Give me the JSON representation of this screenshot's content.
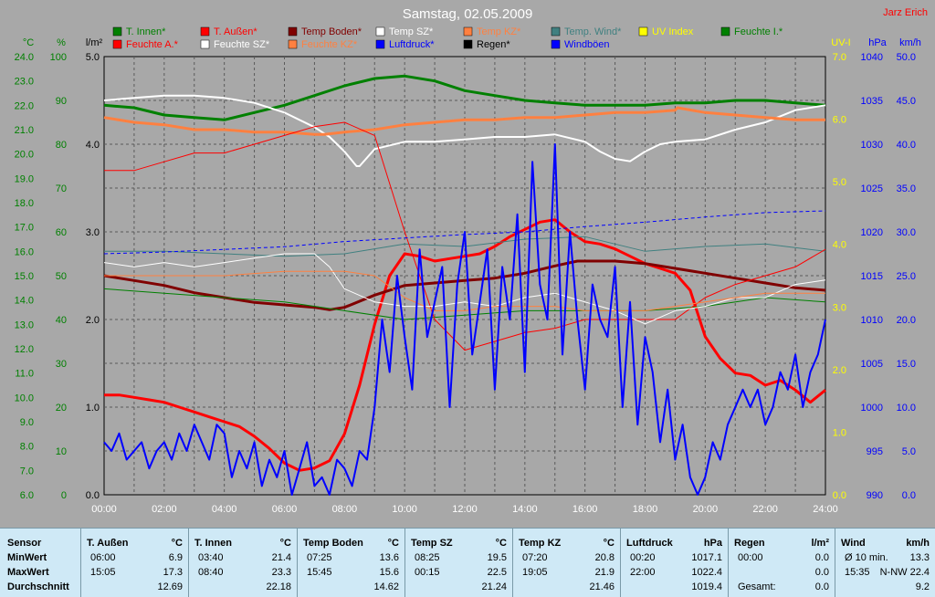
{
  "title": "Samstag, 02.05.2009",
  "author": "Jarz Erich",
  "legend": [
    {
      "label": "T. Innen*",
      "color": "#008000"
    },
    {
      "label": "T. Außen*",
      "color": "#ff0000"
    },
    {
      "label": "Temp Boden*",
      "color": "#800000"
    },
    {
      "label": "Temp SZ*",
      "color": "#ffffff"
    },
    {
      "label": "Temp KZ*",
      "color": "#ff8040"
    },
    {
      "label": "Temp. Wind*",
      "color": "#408080"
    },
    {
      "label": "UV Index",
      "color": "#ffff00"
    },
    {
      "label": "Feuchte I.*",
      "color": "#008000"
    },
    {
      "label": "Feuchte A.*",
      "color": "#ff0000"
    },
    {
      "label": "Feuchte SZ*",
      "color": "#ffffff"
    },
    {
      "label": "Feuchte KZ*",
      "color": "#ff8040"
    },
    {
      "label": "Luftdruck*",
      "color": "#0000ff"
    },
    {
      "label": "Regen*",
      "color": "#000000"
    },
    {
      "label": "Windböen",
      "color": "#0000ff"
    }
  ],
  "axis_units": {
    "temp": "°C",
    "hum": "%",
    "rain": "l/m²",
    "uv": "UV-I",
    "press": "hPa",
    "wind": "km/h"
  },
  "chart_data": {
    "type": "line",
    "x_ticks": [
      "00:00",
      "02:00",
      "04:00",
      "06:00",
      "08:00",
      "10:00",
      "12:00",
      "14:00",
      "16:00",
      "18:00",
      "20:00",
      "22:00",
      "24:00"
    ],
    "axes": {
      "temp": {
        "range": [
          6.0,
          24.0
        ],
        "ticks": [
          "24.0",
          "23.0",
          "22.0",
          "21.0",
          "20.0",
          "19.0",
          "18.0",
          "17.0",
          "16.0",
          "15.0",
          "14.0",
          "13.0",
          "12.0",
          "11.0",
          "10.0",
          "9.0",
          "8.0",
          "7.0",
          "6.0"
        ]
      },
      "hum": {
        "range": [
          0,
          100
        ],
        "ticks": [
          "100",
          "90",
          "80",
          "70",
          "60",
          "50",
          "40",
          "30",
          "20",
          "10",
          "0"
        ]
      },
      "rain": {
        "range": [
          0.0,
          5.0
        ],
        "ticks": [
          "5.0",
          "4.0",
          "3.0",
          "2.0",
          "1.0",
          "0.0"
        ]
      },
      "uv": {
        "range": [
          0.0,
          7.0
        ],
        "ticks": [
          "7.0",
          "6.0",
          "5.0",
          "4.0",
          "3.0",
          "2.0",
          "1.0",
          "0.0"
        ]
      },
      "press": {
        "range": [
          990,
          1040
        ],
        "ticks": [
          "1040",
          "1035",
          "1030",
          "1025",
          "1020",
          "1015",
          "1010",
          "1005",
          "1000",
          "995",
          "990"
        ]
      },
      "wind": {
        "range": [
          0.0,
          50.0
        ],
        "ticks": [
          "50.0",
          "45.0",
          "40.0",
          "35.0",
          "30.0",
          "25.0",
          "20.0",
          "15.0",
          "10.0",
          "5.0",
          "0.0"
        ]
      }
    },
    "series": [
      {
        "name": "T. Innen*",
        "axis": "temp",
        "color": "#008000",
        "width": 3,
        "x": [
          0,
          1,
          2,
          3,
          4,
          5,
          6,
          7,
          8,
          9,
          10,
          11,
          12,
          13,
          14,
          15,
          16,
          17,
          18,
          19,
          20,
          21,
          22,
          23,
          24
        ],
        "y": [
          22.0,
          21.9,
          21.6,
          21.5,
          21.4,
          21.7,
          22.0,
          22.4,
          22.8,
          23.1,
          23.2,
          23.0,
          22.6,
          22.4,
          22.2,
          22.1,
          22.0,
          22.0,
          22.0,
          22.1,
          22.1,
          22.2,
          22.2,
          22.1,
          22.0
        ]
      },
      {
        "name": "T. Außen*",
        "axis": "temp",
        "color": "#ff0000",
        "width": 3,
        "x": [
          0,
          0.5,
          1,
          1.5,
          2,
          2.5,
          3,
          3.5,
          4,
          4.5,
          5,
          5.5,
          6,
          6.5,
          7,
          7.5,
          8,
          8.5,
          9,
          9.5,
          10,
          10.5,
          11,
          11.5,
          12,
          12.5,
          13,
          13.5,
          14,
          14.5,
          15,
          15.5,
          16,
          16.5,
          17,
          17.5,
          18,
          18.5,
          19,
          19.5,
          20,
          20.5,
          21,
          21.5,
          22,
          22.5,
          23,
          23.5,
          24
        ],
        "y": [
          10.1,
          10.1,
          10.0,
          9.9,
          9.8,
          9.6,
          9.4,
          9.2,
          9.0,
          8.8,
          8.4,
          7.9,
          7.3,
          7.0,
          7.1,
          7.4,
          8.5,
          10.5,
          13.0,
          15.0,
          15.9,
          15.8,
          15.6,
          15.7,
          15.8,
          15.9,
          16.2,
          16.6,
          16.9,
          17.2,
          17.3,
          16.8,
          16.4,
          16.3,
          16.1,
          15.8,
          15.5,
          15.3,
          15.1,
          14.4,
          12.5,
          11.6,
          11.0,
          10.9,
          10.5,
          10.7,
          10.3,
          9.8,
          10.3
        ]
      },
      {
        "name": "Temp Boden*",
        "axis": "temp",
        "color": "#800000",
        "width": 3,
        "x": [
          0,
          1,
          2,
          3,
          4,
          5,
          6,
          7,
          7.5,
          8,
          9,
          10,
          11,
          12,
          13,
          14,
          15,
          15.75,
          16,
          17,
          18,
          19,
          20,
          21,
          22,
          23,
          24
        ],
        "y": [
          15.0,
          14.8,
          14.6,
          14.3,
          14.1,
          13.9,
          13.8,
          13.7,
          13.6,
          13.7,
          14.2,
          14.6,
          14.7,
          14.8,
          14.9,
          15.1,
          15.4,
          15.6,
          15.6,
          15.6,
          15.5,
          15.3,
          15.1,
          14.9,
          14.7,
          14.5,
          14.4
        ]
      },
      {
        "name": "Temp SZ*",
        "axis": "temp",
        "color": "#ffffff",
        "width": 2,
        "x": [
          0,
          1,
          2,
          3,
          4,
          5,
          6,
          7,
          7.5,
          8,
          8.4,
          8.5,
          9,
          10,
          11,
          12,
          13,
          14,
          15,
          16,
          16.5,
          17,
          17.5,
          18,
          18.5,
          19,
          20,
          21,
          22,
          23,
          24
        ],
        "y": [
          22.2,
          22.3,
          22.4,
          22.4,
          22.3,
          22.1,
          21.7,
          21.1,
          20.7,
          20.1,
          19.5,
          19.5,
          20.2,
          20.5,
          20.5,
          20.6,
          20.7,
          20.7,
          20.8,
          20.5,
          20.1,
          19.8,
          19.7,
          20.1,
          20.4,
          20.5,
          20.6,
          21.0,
          21.3,
          21.8,
          22.0
        ]
      },
      {
        "name": "Temp KZ*",
        "axis": "temp",
        "color": "#ff8040",
        "width": 3,
        "x": [
          0,
          1,
          2,
          3,
          4,
          5,
          6,
          7,
          7.33,
          8,
          9,
          10,
          11,
          12,
          13,
          14,
          15,
          16,
          17,
          18,
          19,
          19.08,
          20,
          21,
          22,
          23,
          24
        ],
        "y": [
          21.5,
          21.3,
          21.2,
          21.0,
          21.0,
          20.9,
          20.9,
          20.8,
          20.8,
          20.9,
          21.0,
          21.2,
          21.3,
          21.4,
          21.4,
          21.5,
          21.5,
          21.6,
          21.7,
          21.7,
          21.8,
          21.9,
          21.7,
          21.6,
          21.5,
          21.4,
          21.4
        ]
      },
      {
        "name": "Temp. Wind*",
        "axis": "temp",
        "color": "#408080",
        "width": 1,
        "x": [
          0,
          2,
          4,
          6,
          8,
          10,
          12,
          14,
          16,
          18,
          20,
          22,
          24
        ],
        "y": [
          16.0,
          16.0,
          15.9,
          15.8,
          15.9,
          16.3,
          16.2,
          16.5,
          16.6,
          16.0,
          16.2,
          16.3,
          16.0
        ]
      },
      {
        "name": "Feuchte I.*",
        "axis": "hum",
        "color": "#008000",
        "width": 1,
        "x": [
          0,
          2,
          4,
          6,
          8,
          10,
          12,
          14,
          16,
          18,
          20,
          22,
          24
        ],
        "y": [
          47,
          46,
          45,
          44,
          42,
          40,
          41,
          42,
          42,
          42,
          43,
          45,
          44
        ]
      },
      {
        "name": "Feuchte A.*",
        "axis": "hum",
        "color": "#ff0000",
        "width": 1,
        "x": [
          0,
          1,
          2,
          3,
          4,
          5,
          6,
          7,
          8,
          9,
          10,
          11,
          12,
          13,
          14,
          15,
          16,
          17,
          18,
          19,
          20,
          21,
          22,
          23,
          24
        ],
        "y": [
          74,
          74,
          76,
          78,
          78,
          80,
          82,
          84,
          85,
          82,
          60,
          40,
          33,
          35,
          37,
          38,
          40,
          40,
          40,
          40,
          45,
          48,
          50,
          52,
          56
        ]
      },
      {
        "name": "Feuchte SZ*",
        "axis": "hum",
        "color": "#ffffff",
        "width": 1,
        "x": [
          0,
          1,
          2,
          3,
          4,
          5,
          6,
          7,
          7.5,
          8,
          9,
          10,
          11,
          12,
          13,
          14,
          15,
          16,
          17,
          18,
          19,
          20,
          21,
          22,
          23,
          24
        ],
        "y": [
          53,
          52,
          53,
          52,
          53,
          54,
          55,
          55,
          52,
          47,
          44,
          43,
          43,
          44,
          43,
          45,
          46,
          44,
          42,
          39,
          42,
          43,
          45,
          45,
          48,
          49
        ]
      },
      {
        "name": "Feuchte KZ*",
        "axis": "hum",
        "color": "#ff8040",
        "width": 1,
        "x": [
          0,
          2,
          4,
          6,
          8,
          9,
          10,
          11,
          12,
          13,
          14,
          15,
          16,
          17,
          18,
          19,
          20,
          21,
          22,
          23,
          24
        ],
        "y": [
          50,
          50,
          50,
          51,
          51,
          50,
          45,
          42,
          42,
          43,
          43,
          43,
          42,
          42,
          42,
          43,
          44,
          45,
          46,
          46,
          46
        ]
      },
      {
        "name": "Luftdruck*",
        "axis": "press",
        "color": "#0000ff",
        "width": 1,
        "dashed": true,
        "x": [
          0,
          2,
          4,
          6,
          8,
          10,
          12,
          14,
          16,
          18,
          20,
          22,
          24
        ],
        "y": [
          1017.5,
          1017.7,
          1018.0,
          1018.3,
          1018.9,
          1019.3,
          1019.7,
          1020.0,
          1020.6,
          1021.1,
          1021.7,
          1022.2,
          1022.4
        ]
      },
      {
        "name": "Windböen",
        "axis": "wind",
        "color": "#0000ff",
        "width": 2,
        "x": [
          0,
          0.25,
          0.5,
          0.75,
          1,
          1.25,
          1.5,
          1.75,
          2,
          2.25,
          2.5,
          2.75,
          3,
          3.25,
          3.5,
          3.75,
          4,
          4.25,
          4.5,
          4.75,
          5,
          5.25,
          5.5,
          5.75,
          6,
          6.25,
          6.5,
          6.75,
          7,
          7.25,
          7.5,
          7.75,
          8,
          8.25,
          8.5,
          8.75,
          9,
          9.25,
          9.5,
          9.75,
          10,
          10.25,
          10.5,
          10.75,
          11,
          11.25,
          11.5,
          11.75,
          12,
          12.25,
          12.5,
          12.75,
          13,
          13.25,
          13.5,
          13.75,
          14,
          14.25,
          14.5,
          14.75,
          15,
          15.25,
          15.5,
          15.75,
          16,
          16.25,
          16.5,
          16.75,
          17,
          17.25,
          17.5,
          17.75,
          18,
          18.25,
          18.5,
          18.75,
          19,
          19.25,
          19.5,
          19.75,
          20,
          20.25,
          20.5,
          20.75,
          21,
          21.25,
          21.5,
          21.75,
          22,
          22.25,
          22.5,
          22.75,
          23,
          23.25,
          23.5,
          23.75,
          24
        ],
        "y": [
          6,
          5,
          7,
          4,
          5,
          6,
          3,
          5,
          6,
          4,
          7,
          5,
          8,
          6,
          4,
          8,
          7,
          2,
          5,
          3,
          6,
          1,
          4,
          2,
          5,
          0,
          3,
          6,
          1,
          2,
          0,
          4,
          3,
          1,
          5,
          4,
          10,
          20,
          14,
          25,
          18,
          12,
          28,
          18,
          22,
          26,
          10,
          24,
          30,
          16,
          22,
          28,
          12,
          26,
          20,
          32,
          14,
          38,
          24,
          20,
          40,
          16,
          30,
          20,
          12,
          24,
          20,
          18,
          26,
          10,
          22,
          8,
          18,
          14,
          6,
          12,
          4,
          8,
          2,
          0,
          2,
          6,
          4,
          8,
          10,
          12,
          10,
          12,
          8,
          10,
          14,
          12,
          16,
          10,
          14,
          16,
          20
        ]
      }
    ]
  },
  "stats_table": {
    "row_labels": [
      "Sensor",
      "MinWert",
      "MaxWert",
      "Durchschnitt"
    ],
    "columns": [
      {
        "name": "T. Außen",
        "unit": "°C",
        "min_time": "06:00",
        "min_val": "6.9",
        "max_time": "15:05",
        "max_val": "17.3",
        "avg": "12.69"
      },
      {
        "name": "T. Innen",
        "unit": "°C",
        "min_time": "03:40",
        "min_val": "21.4",
        "max_time": "08:40",
        "max_val": "23.3",
        "avg": "22.18"
      },
      {
        "name": "Temp Boden",
        "unit": "°C",
        "min_time": "07:25",
        "min_val": "13.6",
        "max_time": "15:45",
        "max_val": "15.6",
        "avg": "14.62"
      },
      {
        "name": "Temp SZ",
        "unit": "°C",
        "min_time": "08:25",
        "min_val": "19.5",
        "max_time": "00:15",
        "max_val": "22.5",
        "avg": "21.24"
      },
      {
        "name": "Temp KZ",
        "unit": "°C",
        "min_time": "07:20",
        "min_val": "20.8",
        "max_time": "19:05",
        "max_val": "21.9",
        "avg": "21.46"
      },
      {
        "name": "Luftdruck",
        "unit": "hPa",
        "min_time": "00:20",
        "min_val": "1017.1",
        "max_time": "22:00",
        "max_val": "1022.4",
        "avg": "1019.4"
      },
      {
        "name": "Regen",
        "unit": "l/m²",
        "min_time": "00:00",
        "min_val": "0.0",
        "max_time": "",
        "max_val": "0.0",
        "avg_label": "Gesamt:",
        "avg": "0.0"
      },
      {
        "name": "Wind",
        "unit": "km/h",
        "min_time": "Ø 10 min.",
        "min_val": "13.3",
        "max_time": "15:35",
        "max_val": "N-NW 22.4",
        "avg": "9.2"
      }
    ]
  }
}
